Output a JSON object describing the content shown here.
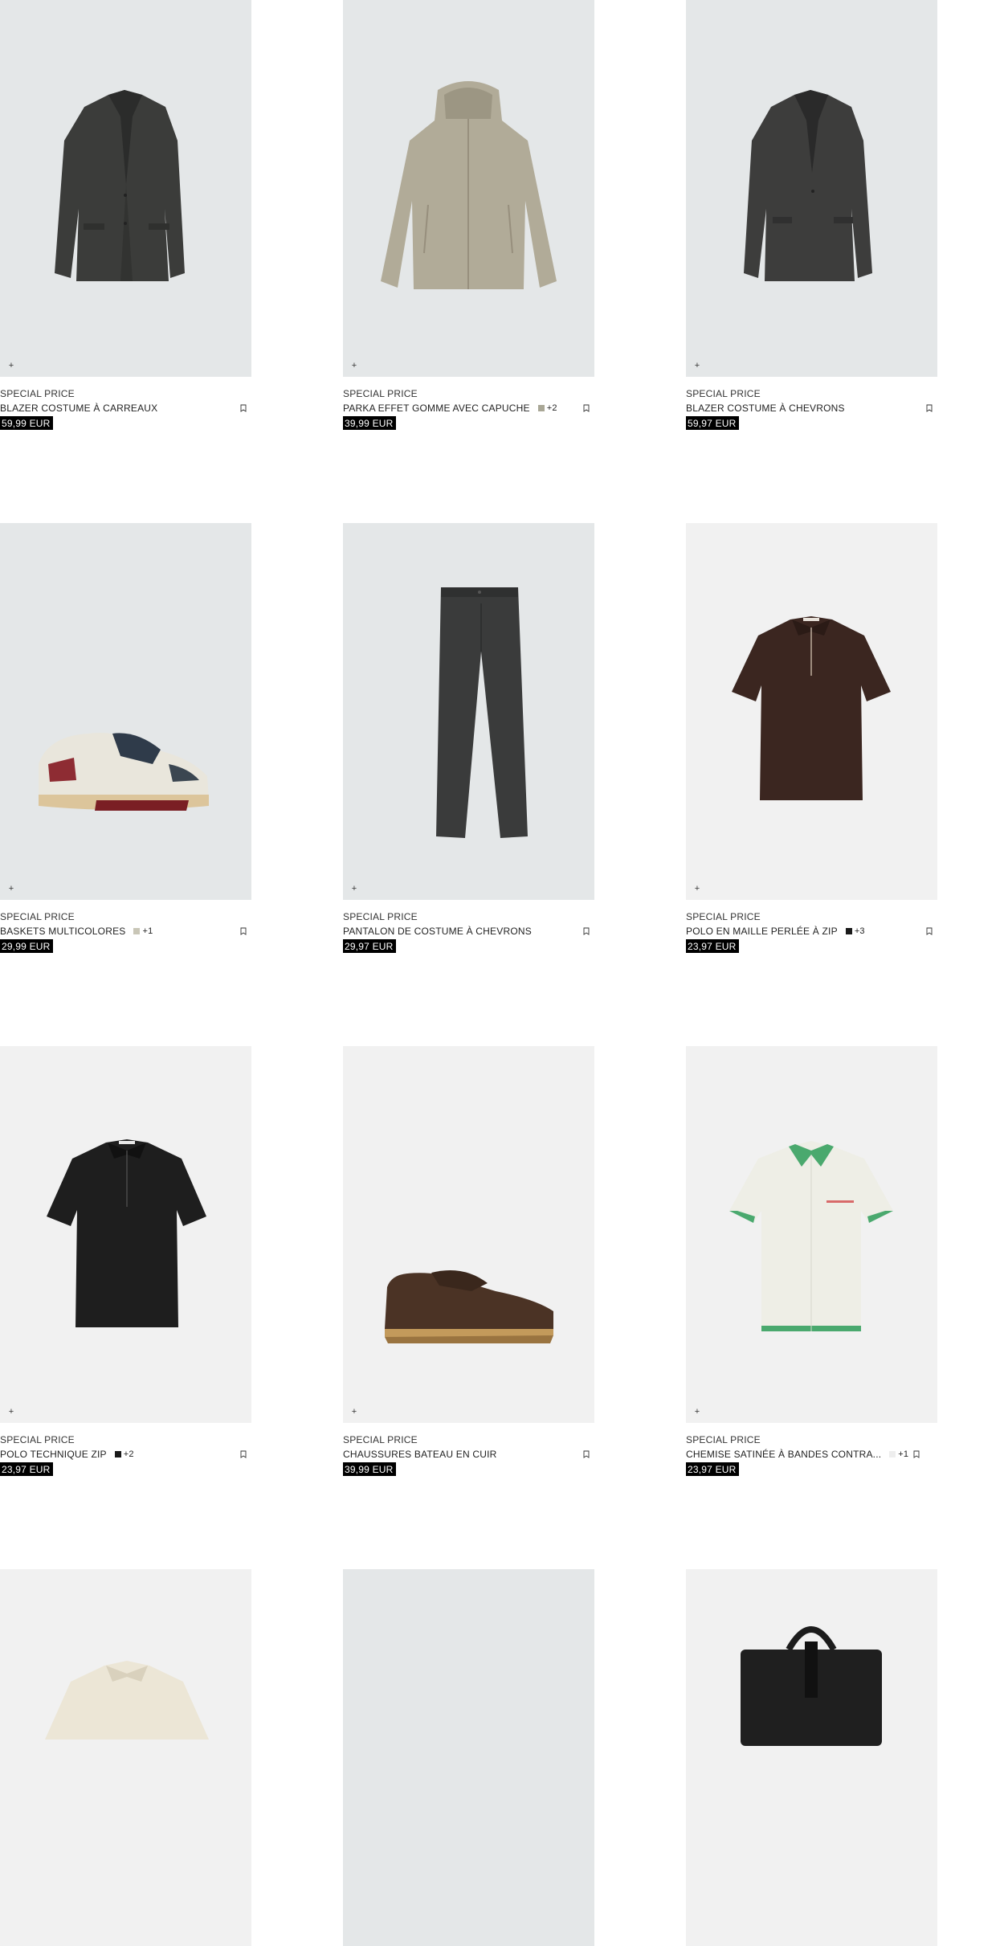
{
  "products": [
    {
      "tag": "SPECIAL PRICE",
      "name": "BLAZER COSTUME À CARREAUX",
      "price": "59,99 EUR",
      "bg": "#e4e7e8",
      "icon": "blazer-dark-image"
    },
    {
      "tag": "SPECIAL PRICE",
      "name": "PARKA EFFET GOMME AVEC CAPUCHE",
      "more": "+2",
      "swatch": "#a9a796",
      "price": "39,99 EUR",
      "bg": "#e4e7e8",
      "icon": "parka-beige-image"
    },
    {
      "tag": "SPECIAL PRICE",
      "name": "BLAZER COSTUME À CHEVRONS",
      "price": "59,97 EUR",
      "bg": "#e4e7e8",
      "icon": "blazer-dark-image"
    },
    {
      "tag": "SPECIAL PRICE",
      "name": "BASKETS MULTICOLORES",
      "more": "+1",
      "swatch": "#c9c6b7",
      "price": "29,99 EUR",
      "bg": "#e4e7e8",
      "icon": "sneaker-image"
    },
    {
      "tag": "SPECIAL PRICE",
      "name": "PANTALON DE COSTUME À CHEVRONS",
      "price": "29,97 EUR",
      "bg": "#e4e7e8",
      "icon": "trousers-image"
    },
    {
      "tag": "SPECIAL PRICE",
      "name": "POLO EN MAILLE PERLÉE À ZIP",
      "more": "+3",
      "swatch": "#1a1a1a",
      "price": "23,97 EUR",
      "bg": "#f1f1f1",
      "icon": "polo-brown-image"
    },
    {
      "tag": "SPECIAL PRICE",
      "name": "POLO TECHNIQUE ZIP",
      "more": "+2",
      "swatch": "#1a1a1a",
      "price": "23,97 EUR",
      "bg": "#f1f1f1",
      "icon": "polo-black-image"
    },
    {
      "tag": "SPECIAL PRICE",
      "name": "CHAUSSURES BATEAU EN CUIR",
      "price": "39,99 EUR",
      "bg": "#f1f1f1",
      "icon": "boat-shoe-image"
    },
    {
      "tag": "SPECIAL PRICE",
      "name": "CHEMISE SATINÉE À BANDES CONTRA...",
      "more": "+1",
      "swatch": "#eeeeee",
      "price": "23,97 EUR",
      "bg": "#f1f1f1",
      "icon": "shirt-green-trim-image"
    },
    {
      "bg": "#f1f1f1",
      "icon": "overshirt-cream-image"
    },
    {
      "bg": "#e4e7e8",
      "icon": "product-image"
    },
    {
      "bg": "#f1f1f1",
      "icon": "bag-black-image"
    }
  ]
}
